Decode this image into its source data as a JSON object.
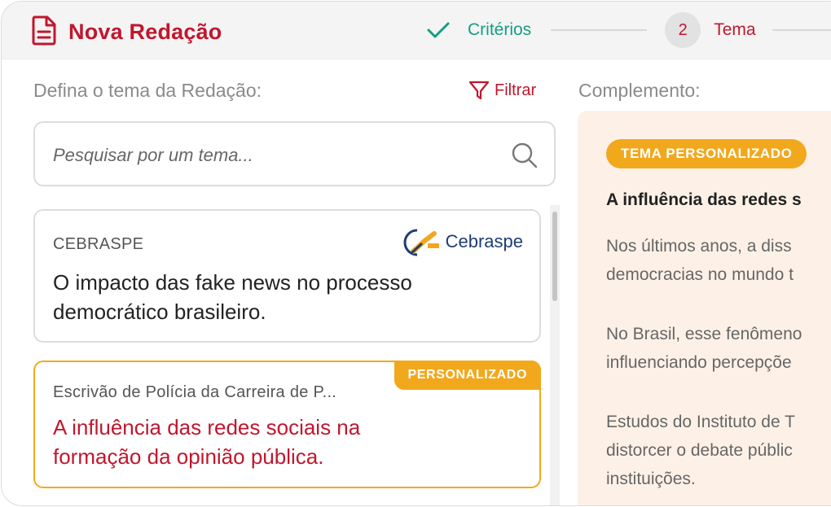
{
  "header": {
    "title": "Nova Redação",
    "steps": [
      {
        "number": "",
        "label": "Critérios",
        "state": "done"
      },
      {
        "number": "2",
        "label": "Tema",
        "state": "active"
      }
    ]
  },
  "left": {
    "label": "Defina o tema da Redação:",
    "filter_label": "Filtrar",
    "search_placeholder": "Pesquisar por um tema..."
  },
  "cards": [
    {
      "source": "CEBRASPE",
      "logo_text": "Cebraspe",
      "title_line1": "O impacto das fake news no processo",
      "title_line2": "democrático brasileiro."
    },
    {
      "badge": "PERSONALIZADO",
      "source": "Escrivão de Polícia da Carreira de P...",
      "title_line1": "A influência das redes sociais na",
      "title_line2": "formação da opinião pública."
    }
  ],
  "complement": {
    "label": "Complemento:",
    "badge": "TEMA PERSONALIZADO",
    "title": "A influência das redes s",
    "paragraphs": [
      [
        "Nos últimos anos, a diss",
        "democracias no mundo t"
      ],
      [
        "No Brasil, esse fenômeno",
        "influenciando percepçõe"
      ],
      [
        "Estudos do Instituto de T",
        "distorcer o debate públic",
        "instituições."
      ]
    ]
  },
  "colors": {
    "brand_red": "#c0172e",
    "success_green": "#169c84",
    "accent_orange": "#f2a81d",
    "panel_bg": "#fdf1e7"
  },
  "icons": [
    "document-icon",
    "checkmark-icon",
    "filter-icon",
    "search-icon",
    "cebraspe-logo"
  ]
}
